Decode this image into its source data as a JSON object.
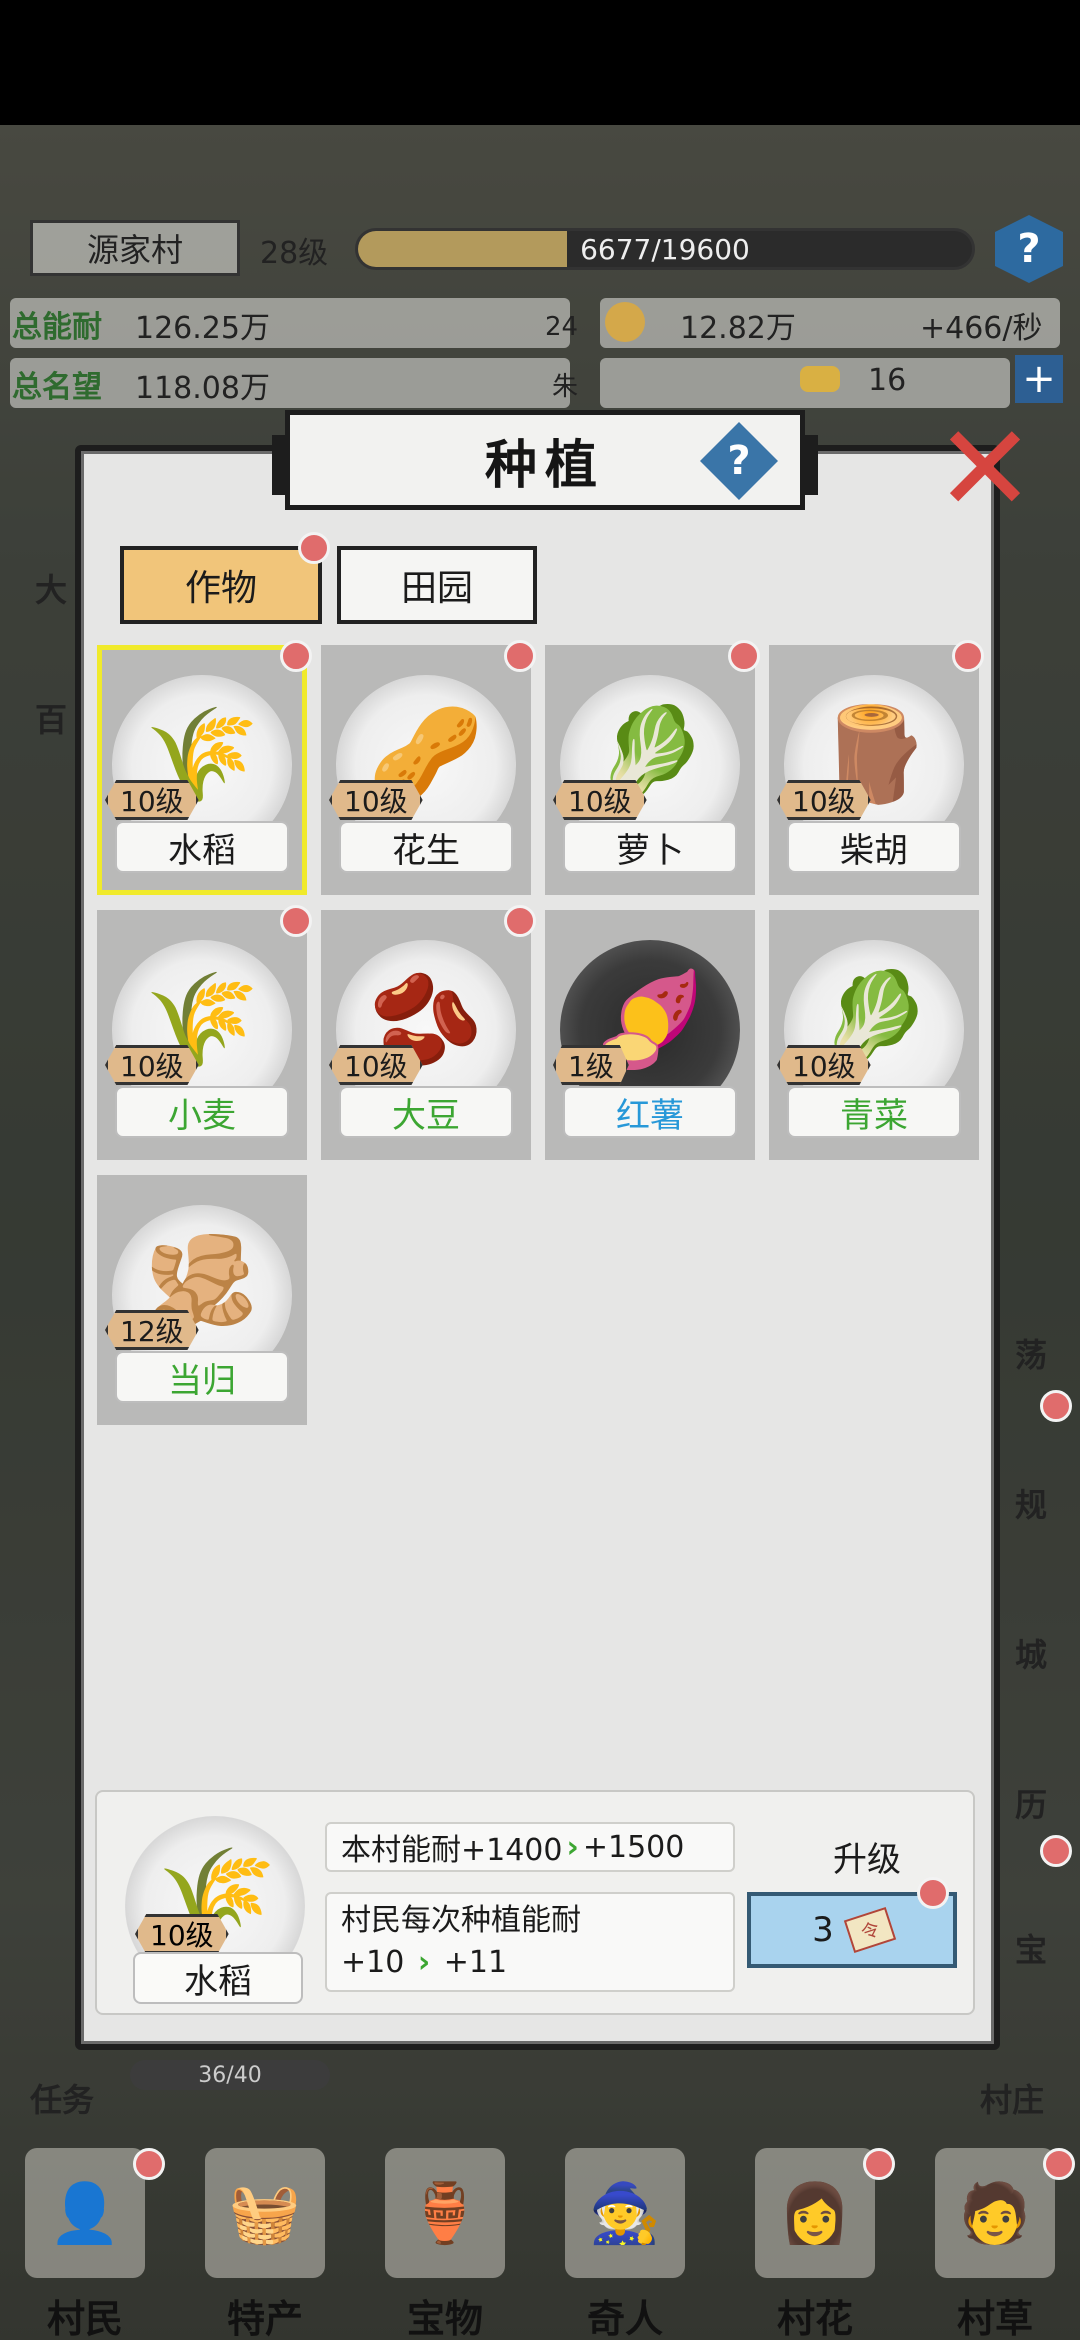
{
  "hud": {
    "village_name": "源家村",
    "village_level": "28级",
    "xp_text": "6677/19600",
    "xp_progress": 0.34,
    "total_energy_label": "总能耐",
    "total_energy": "126.25万",
    "total_fame_label": "总名望",
    "total_fame": "118.08万",
    "badge_level": "24",
    "badge_char": "朱",
    "coins": "12.82万",
    "coin_rate": "+466/秒",
    "gold": "16"
  },
  "side_labels": {
    "right_1": "荡",
    "right_2": "规",
    "right_3": "城",
    "right_4": "历",
    "right_5": "宝",
    "right_6": "村庄",
    "left_1": "大",
    "left_2": "百"
  },
  "task": {
    "label": "任务",
    "progress_text": "36/40"
  },
  "modal": {
    "title": "种植",
    "help_symbol": "?",
    "close_symbol": "✕",
    "tabs": [
      {
        "label": "作物",
        "active": true
      },
      {
        "label": "田园",
        "active": false
      }
    ],
    "crops": [
      {
        "name": "水稻",
        "level": "10级",
        "icon": "rice-icon",
        "emoji": "🌾",
        "color": "default",
        "dot": true,
        "selected": true
      },
      {
        "name": "花生",
        "level": "10级",
        "icon": "peanut-icon",
        "emoji": "🥜",
        "color": "default",
        "dot": true,
        "selected": false
      },
      {
        "name": "萝卜",
        "level": "10级",
        "icon": "radish-icon",
        "emoji": "🥬",
        "color": "default",
        "dot": true,
        "selected": false
      },
      {
        "name": "柴胡",
        "level": "10级",
        "icon": "bupleurum-root-icon",
        "emoji": "🪵",
        "color": "default",
        "dot": true,
        "selected": false
      },
      {
        "name": "小麦",
        "level": "10级",
        "icon": "wheat-icon",
        "emoji": "🌾",
        "color": "green",
        "dot": true,
        "selected": false
      },
      {
        "name": "大豆",
        "level": "10级",
        "icon": "soybean-icon",
        "emoji": "🫘",
        "color": "green",
        "dot": true,
        "selected": false
      },
      {
        "name": "红薯",
        "level": "1级",
        "icon": "sweet-potato-icon",
        "emoji": "🍠",
        "color": "blue",
        "dot": false,
        "selected": false
      },
      {
        "name": "青菜",
        "level": "10级",
        "icon": "greens-icon",
        "emoji": "🥬",
        "color": "green",
        "dot": false,
        "selected": false
      },
      {
        "name": "当归",
        "level": "12级",
        "icon": "angelica-root-icon",
        "emoji": "🫚",
        "color": "green",
        "dot": false,
        "selected": false
      }
    ],
    "detail": {
      "name": "水稻",
      "level": "10级",
      "stat1_text": "本村能耐+1400",
      "stat1_next": "+1500",
      "stat2_line1": "村民每次种植能耐",
      "stat2_value": "+10",
      "stat2_next": "+11",
      "upgrade_label": "升级",
      "upgrade_cost": "3",
      "ticket_text": "令"
    }
  },
  "bottom_nav": [
    {
      "label": "村民",
      "icon": "villager-icon",
      "glyph": "👤",
      "dot": true
    },
    {
      "label": "特产",
      "icon": "specialty-icon",
      "glyph": "🧺",
      "dot": false
    },
    {
      "label": "宝物",
      "icon": "treasure-icon",
      "glyph": "🏺",
      "dot": false
    },
    {
      "label": "奇人",
      "icon": "stranger-icon",
      "glyph": "🧙",
      "dot": false
    },
    {
      "label": "村花",
      "icon": "village-belle-icon",
      "glyph": "👩",
      "dot": true
    },
    {
      "label": "村草",
      "icon": "village-hunk-icon",
      "glyph": "🧑",
      "dot": true
    }
  ],
  "colors": {
    "active_tab": "#f1c57a",
    "selected_outline": "#f0ea2b",
    "notify_dot": "#e06c6c",
    "green_text": "#3ca632",
    "blue_text": "#2798d8",
    "close": "#d6453f"
  }
}
